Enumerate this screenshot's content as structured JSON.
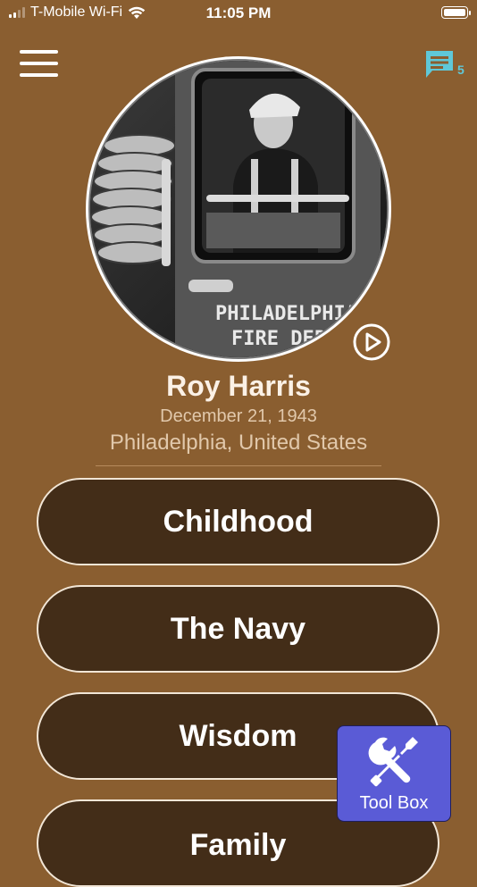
{
  "status_bar": {
    "carrier": "T-Mobile Wi-Fi",
    "time": "11:05 PM"
  },
  "header": {
    "menu_icon": "hamburger-icon",
    "chat_icon": "chat-icon",
    "chat_count": "5",
    "accent_color": "#5fc8d8"
  },
  "profile": {
    "photo_sign_line1": "PHILADELPHIA",
    "photo_sign_line2": "FIRE DEPT",
    "name": "Roy Harris",
    "date": "December 21, 1943",
    "location": "Philadelphia, United States"
  },
  "chapters": [
    {
      "label": "Childhood"
    },
    {
      "label": "The Navy"
    },
    {
      "label": "Wisdom"
    },
    {
      "label": "Family"
    }
  ],
  "toolbox": {
    "label": "Tool Box",
    "icon": "tools-icon",
    "color": "#5a5bd6"
  },
  "colors": {
    "background": "#8a5e30",
    "button": "#432d18"
  }
}
